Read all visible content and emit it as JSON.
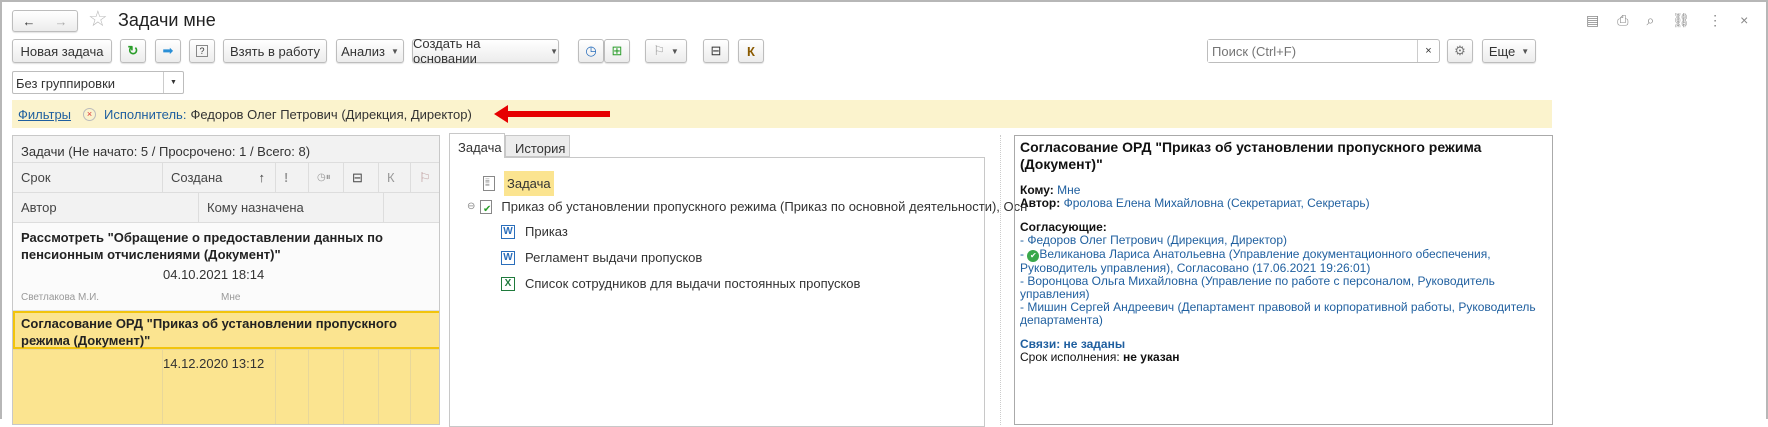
{
  "window": {
    "title": "Задачи мне"
  },
  "toolbar": {
    "new_task": "Новая задача",
    "take": "Взять в работу",
    "analysis": "Анализ",
    "create_based": "Создать на основании",
    "k": "К",
    "search_placeholder": "Поиск (Ctrl+F)",
    "more": "Еще"
  },
  "grouping": {
    "value": "Без группировки"
  },
  "filter": {
    "filters_link": "Фильтры",
    "label": "Исполнитель:",
    "value": "Федоров Олег Петрович (Дирекция, Директор)"
  },
  "list": {
    "summary": "Задачи (Не начато: 5 / Просрочено: 1 / Всего: 8)",
    "columns": {
      "deadline": "Срок",
      "created": "Создана",
      "sort": "↑",
      "k": "К",
      "author": "Автор",
      "assignee": "Кому назначена"
    },
    "rows": [
      {
        "title": "Рассмотреть \"Обращение о предоставлении данных по пенсионным отчислениями (Документ)\"",
        "created": "04.10.2021 18:14",
        "author": "Светлакова М.И.",
        "assignee": "Мне"
      },
      {
        "title": "Согласование ОРД \"Приказ об установлении пропускного режима (Документ)\"",
        "created": "14.12.2020 13:12"
      }
    ]
  },
  "middle": {
    "tabs": [
      {
        "label": "Задача",
        "active": true
      },
      {
        "label": "История",
        "active": false
      }
    ],
    "tree": {
      "task": "Задача",
      "document": "Приказ об установлении пропускного режима (Приказ по основной деятельности), Осн",
      "files": [
        "Приказ",
        "Регламент выдачи пропусков",
        "Список сотрудников для выдачи постоянных пропусков"
      ]
    }
  },
  "detail": {
    "title": "Согласование ОРД \"Приказ об установлении пропускного режима (Документ)\"",
    "to_label": "Кому:",
    "to": "Мне",
    "author_label": "Автор:",
    "author": "Фролова Елена Михайловна (Секретариат, Секретарь)",
    "approvers_label": "Согласующие:",
    "approvers": [
      "- Федоров Олег Петрович (Дирекция, Директор)",
      "Великанова Лариса Анатольевна (Управление документационного обеспечения, Руководитель управления), Согласовано (17.06.2021 19:26:01)",
      "- Воронцова Ольга Михайловна (Управление по работе с персоналом, Руководитель управления)",
      "- Мишин Сергей Андреевич (Департамент правовой и корпоративной работы, Руководитель департамента)"
    ],
    "approver2_prefix": "- ",
    "links": "Связи: не заданы",
    "deadline_label": "Срок исполнения:",
    "deadline": "не указан"
  },
  "colors": {
    "accent_link": "#1f5f9f",
    "filter_bg": "#fbf3cd",
    "selected_row": "#fbe490",
    "arrow": "#e60000"
  }
}
